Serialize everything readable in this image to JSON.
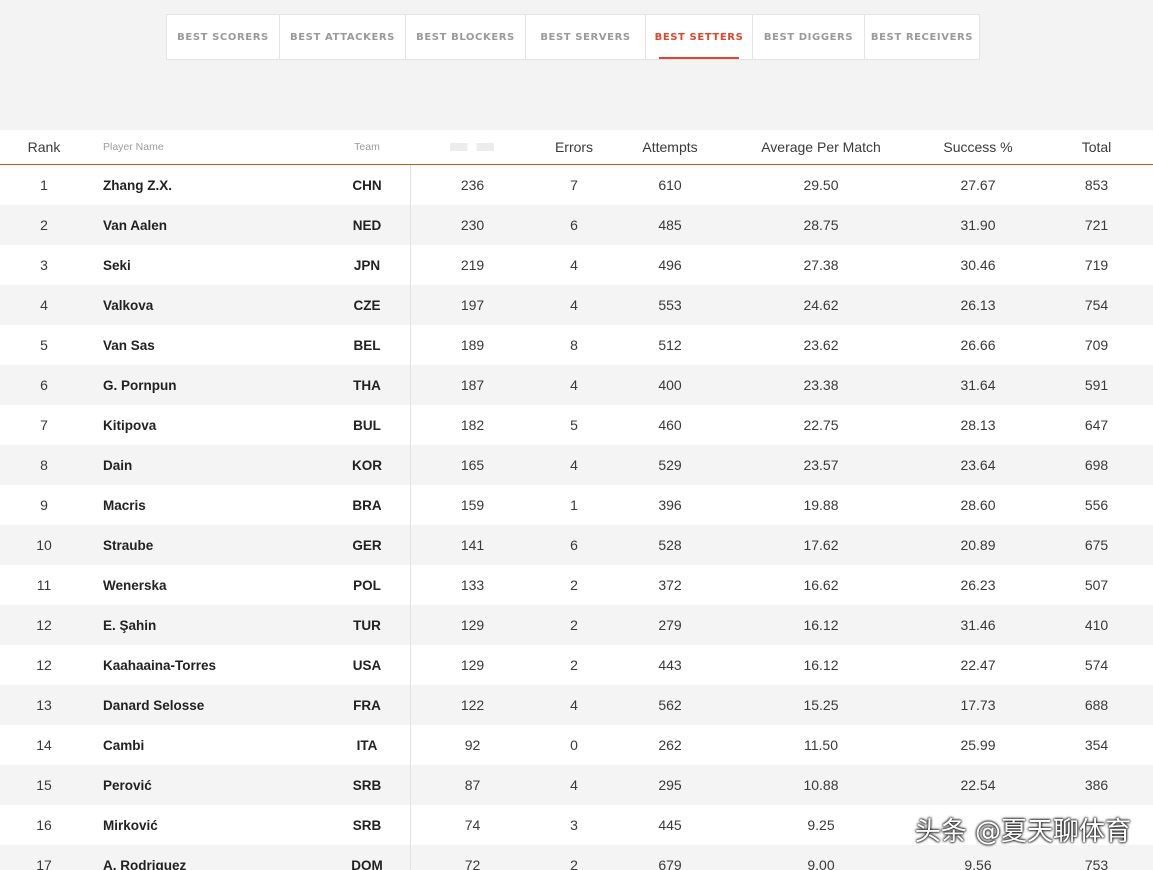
{
  "tabs": [
    {
      "label": "BEST SCORERS",
      "active": false
    },
    {
      "label": "BEST ATTACKERS",
      "active": false
    },
    {
      "label": "BEST BLOCKERS",
      "active": false
    },
    {
      "label": "BEST SERVERS",
      "active": false
    },
    {
      "label": "BEST SETTERS",
      "active": true
    },
    {
      "label": "BEST DIGGERS",
      "active": false
    },
    {
      "label": "BEST RECEIVERS",
      "active": false
    }
  ],
  "colors": {
    "accent": "#e0462c",
    "header_text": "#9d9d9d",
    "row_alt": "#f4f4f4"
  },
  "table": {
    "headers": {
      "rank": "Rank",
      "player": "Player Name",
      "team": "Team",
      "errors": "Errors",
      "attempts": "Attempts",
      "average": "Average Per Match",
      "success": "Success %",
      "total": "Total"
    },
    "rows": [
      {
        "rank": "1",
        "player": "Zhang Z.X.",
        "team": "CHN",
        "sets": "236",
        "errors": "7",
        "attempts": "610",
        "average": "29.50",
        "success": "27.67",
        "total": "853"
      },
      {
        "rank": "2",
        "player": "Van Aalen",
        "team": "NED",
        "sets": "230",
        "errors": "6",
        "attempts": "485",
        "average": "28.75",
        "success": "31.90",
        "total": "721"
      },
      {
        "rank": "3",
        "player": "Seki",
        "team": "JPN",
        "sets": "219",
        "errors": "4",
        "attempts": "496",
        "average": "27.38",
        "success": "30.46",
        "total": "719"
      },
      {
        "rank": "4",
        "player": "Valkova",
        "team": "CZE",
        "sets": "197",
        "errors": "4",
        "attempts": "553",
        "average": "24.62",
        "success": "26.13",
        "total": "754"
      },
      {
        "rank": "5",
        "player": "Van Sas",
        "team": "BEL",
        "sets": "189",
        "errors": "8",
        "attempts": "512",
        "average": "23.62",
        "success": "26.66",
        "total": "709"
      },
      {
        "rank": "6",
        "player": "G. Pornpun",
        "team": "THA",
        "sets": "187",
        "errors": "4",
        "attempts": "400",
        "average": "23.38",
        "success": "31.64",
        "total": "591"
      },
      {
        "rank": "7",
        "player": "Kitipova",
        "team": "BUL",
        "sets": "182",
        "errors": "5",
        "attempts": "460",
        "average": "22.75",
        "success": "28.13",
        "total": "647"
      },
      {
        "rank": "8",
        "player": "Dain",
        "team": "KOR",
        "sets": "165",
        "errors": "4",
        "attempts": "529",
        "average": "23.57",
        "success": "23.64",
        "total": "698"
      },
      {
        "rank": "9",
        "player": "Macris",
        "team": "BRA",
        "sets": "159",
        "errors": "1",
        "attempts": "396",
        "average": "19.88",
        "success": "28.60",
        "total": "556"
      },
      {
        "rank": "10",
        "player": "Straube",
        "team": "GER",
        "sets": "141",
        "errors": "6",
        "attempts": "528",
        "average": "17.62",
        "success": "20.89",
        "total": "675"
      },
      {
        "rank": "11",
        "player": "Wenerska",
        "team": "POL",
        "sets": "133",
        "errors": "2",
        "attempts": "372",
        "average": "16.62",
        "success": "26.23",
        "total": "507"
      },
      {
        "rank": "12",
        "player": "E. Şahin",
        "team": "TUR",
        "sets": "129",
        "errors": "2",
        "attempts": "279",
        "average": "16.12",
        "success": "31.46",
        "total": "410"
      },
      {
        "rank": "12",
        "player": "Kaahaaina-Torres",
        "team": "USA",
        "sets": "129",
        "errors": "2",
        "attempts": "443",
        "average": "16.12",
        "success": "22.47",
        "total": "574"
      },
      {
        "rank": "13",
        "player": "Danard Selosse",
        "team": "FRA",
        "sets": "122",
        "errors": "4",
        "attempts": "562",
        "average": "15.25",
        "success": "17.73",
        "total": "688"
      },
      {
        "rank": "14",
        "player": "Cambi",
        "team": "ITA",
        "sets": "92",
        "errors": "0",
        "attempts": "262",
        "average": "11.50",
        "success": "25.99",
        "total": "354"
      },
      {
        "rank": "15",
        "player": "Perović",
        "team": "SRB",
        "sets": "87",
        "errors": "4",
        "attempts": "295",
        "average": "10.88",
        "success": "22.54",
        "total": "386"
      },
      {
        "rank": "16",
        "player": "Mirković",
        "team": "SRB",
        "sets": "74",
        "errors": "3",
        "attempts": "445",
        "average": "9.25",
        "success": "",
        "total": ""
      },
      {
        "rank": "17",
        "player": "A. Rodriguez",
        "team": "DOM",
        "sets": "72",
        "errors": "2",
        "attempts": "679",
        "average": "9.00",
        "success": "9.56",
        "total": "753"
      }
    ]
  },
  "watermark": {
    "text": "头条 @夏天聊体育"
  }
}
